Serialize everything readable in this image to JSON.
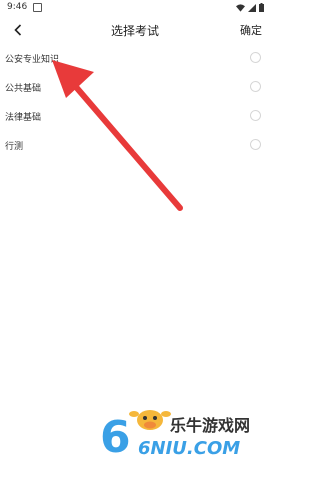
{
  "status_bar": {
    "time": "9:46"
  },
  "header": {
    "title": "选择考试",
    "confirm_label": "确定"
  },
  "options": [
    {
      "label": "公安专业知识",
      "selected": false
    },
    {
      "label": "公共基础",
      "selected": false
    },
    {
      "label": "法律基础",
      "selected": false
    },
    {
      "label": "行测",
      "selected": false
    }
  ],
  "watermark": {
    "text": "乐牛游戏网",
    "domain": "6NIU.COM"
  },
  "colors": {
    "annotation_arrow": "#e83a3a",
    "radio_border": "#d6d6d6"
  }
}
